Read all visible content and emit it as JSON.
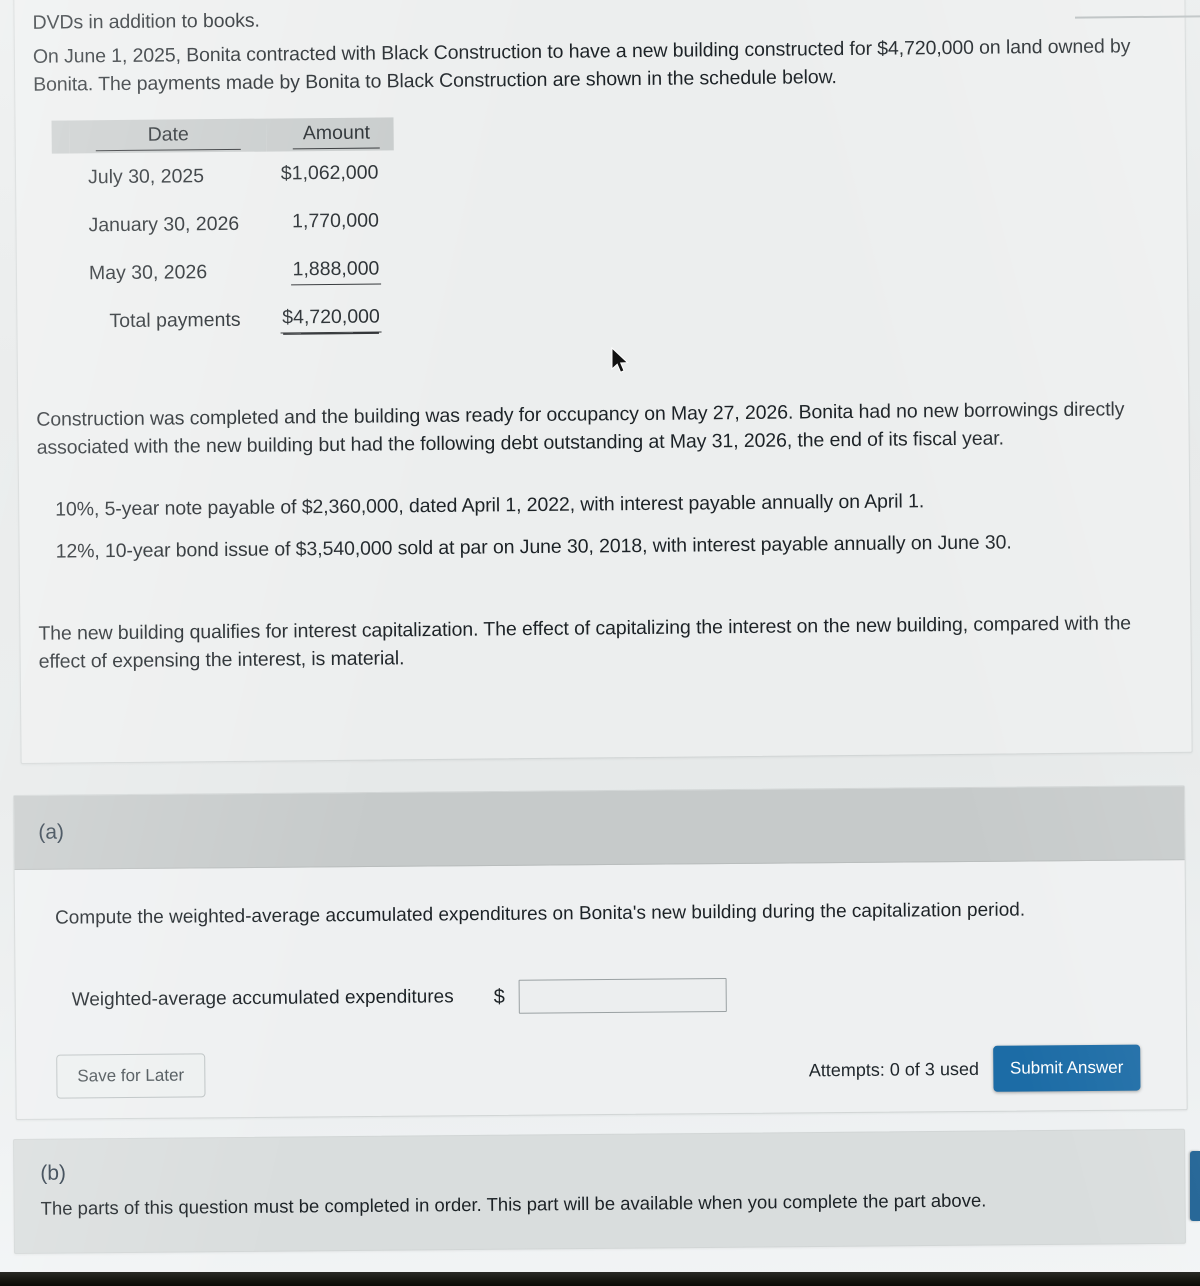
{
  "stem": {
    "fragment_top": "DVDs in addition to books.",
    "intro": "On June 1, 2025, Bonita contracted with Black Construction to have a new building constructed for $4,720,000 on land owned by Bonita. The payments made by Bonita to Black Construction are shown in the schedule below.",
    "completion": "Construction was completed and the building was ready for occupancy on May 27, 2026. Bonita had no new borrowings directly associated with the new building but had the following debt outstanding at May 31, 2026, the end of its fiscal year.",
    "debt_1": "10%, 5-year note payable of $2,360,000, dated April 1, 2022, with interest payable annually on April 1.",
    "debt_2": "12%, 10-year bond issue of $3,540,000 sold at par on June 30, 2018, with interest payable annually on June 30.",
    "materiality": "The new building qualifies for interest capitalization. The effect of capitalizing the interest on the new building, compared with the effect of expensing the interest, is material."
  },
  "schedule": {
    "headers": [
      "Date",
      "Amount"
    ],
    "rows": [
      {
        "date": "July 30, 2025",
        "amount": "$1,062,000",
        "rule": "none"
      },
      {
        "date": "January 30, 2026",
        "amount": "1,770,000",
        "rule": "none"
      },
      {
        "date": "May 30, 2026",
        "amount": "1,888,000",
        "rule": "single"
      }
    ],
    "total": {
      "label": "Total payments",
      "amount": "$4,720,000",
      "rule": "double"
    }
  },
  "part_a": {
    "label": "(a)",
    "prompt": "Compute the weighted-average accumulated expenditures on Bonita's new building during the capitalization period.",
    "answer_label": "Weighted-average accumulated expenditures",
    "currency_symbol": "$",
    "answer_value": "",
    "answer_placeholder": ""
  },
  "actions": {
    "save_label": "Save for Later",
    "attempts_text": "Attempts: 0 of 3 used",
    "submit_label": "Submit Answer",
    "submit_color": "#1c6ca6"
  },
  "part_b": {
    "label": "(b)",
    "locked_message": "The parts of this question must be completed in order. This part will be available when you complete the part above."
  }
}
